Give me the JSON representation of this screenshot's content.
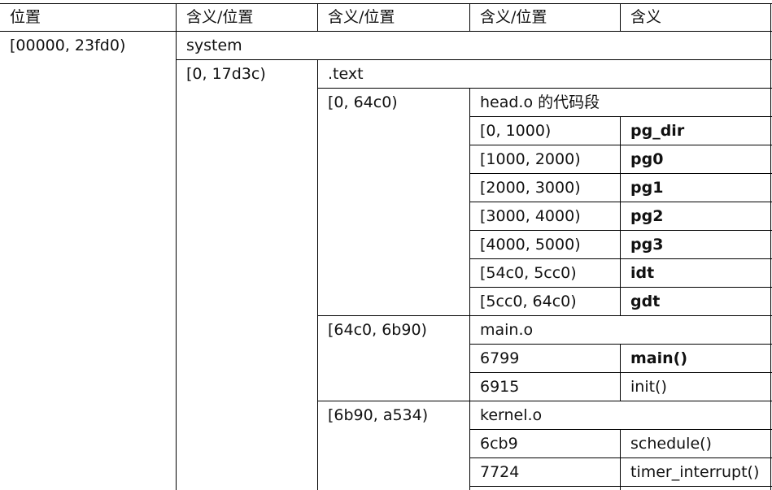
{
  "headers": [
    "位置",
    "含义/位置",
    "含义/位置",
    "含义/位置",
    "含义"
  ],
  "rows": {
    "system_range": "[00000, 23fd0)",
    "system_label": "system",
    "text_range": "[0, 17d3c)",
    "text_label": ".text",
    "head_range": "[0, 64c0)",
    "head_label": "head.o 的代码段",
    "head_entries": [
      {
        "range": "[0, 1000)",
        "name": "pg_dir"
      },
      {
        "range": "[1000, 2000)",
        "name": "pg0"
      },
      {
        "range": "[2000, 3000)",
        "name": "pg1"
      },
      {
        "range": "[3000, 4000)",
        "name": "pg2"
      },
      {
        "range": "[4000, 5000)",
        "name": "pg3"
      },
      {
        "range": "[54c0, 5cc0)",
        "name": "idt"
      },
      {
        "range": "[5cc0, 64c0)",
        "name": "gdt"
      }
    ],
    "main_range": "[64c0, 6b90)",
    "main_label": "main.o",
    "main_entries": [
      {
        "range": "6799",
        "name": "main()"
      },
      {
        "range": "6915",
        "name": "init()"
      }
    ],
    "kernel_range": "[6b90, a534)",
    "kernel_label": "kernel.o",
    "kernel_entries": [
      {
        "range": "6cb9",
        "name": "schedule()"
      },
      {
        "range": "7724",
        "name": "timer_interrupt()"
      }
    ]
  }
}
